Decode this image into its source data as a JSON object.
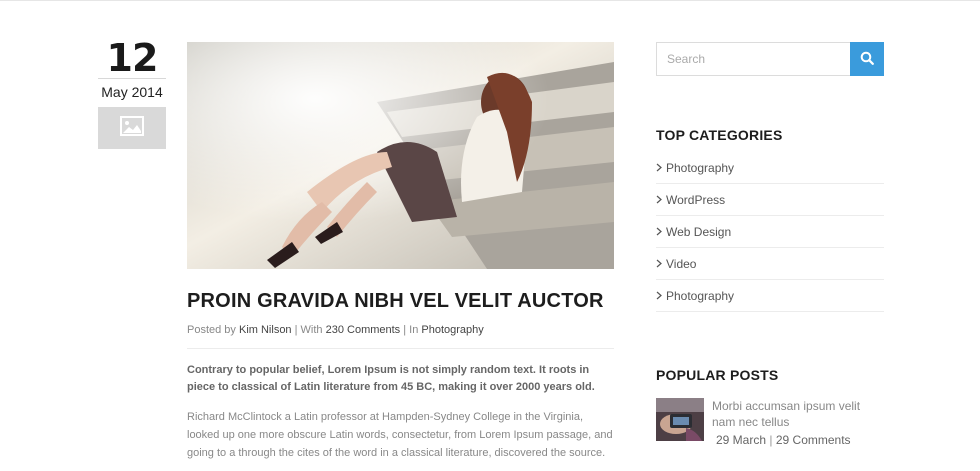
{
  "date": {
    "day": "12",
    "month_year": "May 2014"
  },
  "post": {
    "title": "PROIN GRAVIDA NIBH VEL VELIT AUCTOR",
    "meta": {
      "posted_by": "Posted by",
      "author": "Kim Nilson",
      "with": " | With ",
      "comments": "230 Comments",
      "in": " | In ",
      "category": "Photography"
    },
    "lead": "Contrary to popular belief, Lorem Ipsum is not simply random text. It roots in piece to classical of Latin literature from 45 BC, making it over 2000 years old.",
    "body": "Richard McClintock a Latin professor at Hampden-Sydney College in the Virginia, looked up one more obscure Latin words, consectetur, from Lorem Ipsum passage, and going to a through the cites of the word in a classical literature, discovered the source."
  },
  "sidebar": {
    "search": {
      "placeholder": "Search"
    },
    "categories": {
      "title": "TOP CATEGORIES",
      "items": [
        "Photography",
        "WordPress",
        "Web Design",
        "Video",
        "Photography"
      ]
    },
    "popular": {
      "title": "POPULAR POSTS",
      "items": [
        {
          "title": "Morbi accumsan ipsum velit nam nec tellus",
          "date": "29 March",
          "comments": "29 Comments"
        }
      ]
    }
  },
  "colors": {
    "accent": "#3a9bdc",
    "format_box": "#d9d9d9",
    "heading": "#1d1d1d"
  },
  "icons": {
    "format": "image-icon",
    "search": "search-icon",
    "bullet": "chevron-right-icon"
  }
}
